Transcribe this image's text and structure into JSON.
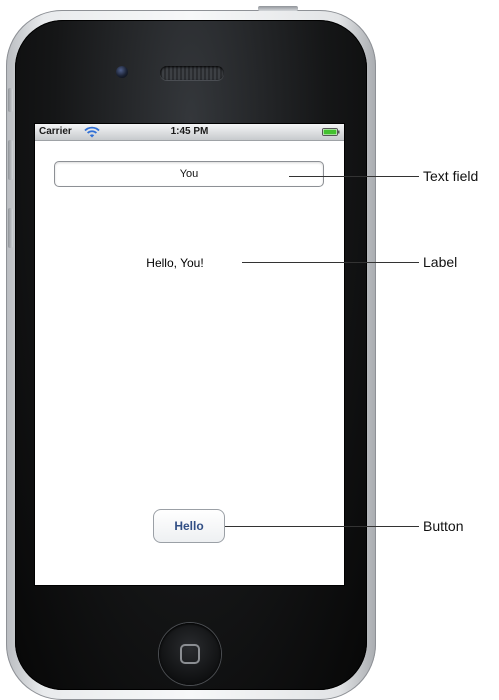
{
  "status_bar": {
    "carrier": "Carrier",
    "time": "1:45 PM",
    "wifi_icon": "wifi-icon",
    "battery_icon": "battery-icon",
    "battery_color": "#43c12f"
  },
  "app": {
    "text_field_value": "You",
    "label_text": "Hello, You!",
    "button_label": "Hello",
    "button_text_color": "#324f85"
  },
  "callouts": {
    "text_field": "Text field",
    "label": "Label",
    "button": "Button"
  },
  "icons": {
    "camera": "camera-icon",
    "speaker": "speaker-grille-icon",
    "home": "home-button-icon"
  }
}
